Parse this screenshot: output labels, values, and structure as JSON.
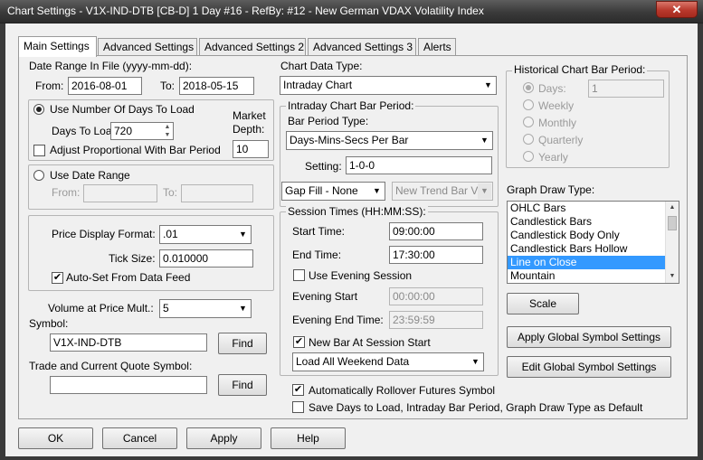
{
  "window": {
    "title": "Chart Settings - V1X-IND-DTB [CB-D]  1 Day    #16 - RefBy: #12 - New German VDAX Volatility Index",
    "close": "✕"
  },
  "tabs": [
    "Main Settings",
    "Advanced Settings",
    "Advanced Settings 2",
    "Advanced Settings 3",
    "Alerts"
  ],
  "date_range": {
    "label": "Date Range In File (yyyy-mm-dd):",
    "from_label": "From:",
    "from_value": "2016-08-01",
    "to_label": "To:",
    "to_value": "2018-05-15"
  },
  "days_group": {
    "use_days_label": "Use Number Of Days To Load",
    "days_to_load_label": "Days To Load:",
    "days_to_load_value": "720",
    "market_depth_label_1": "Market",
    "market_depth_label_2": "Depth:",
    "market_depth_value": "10",
    "adjust_label": "Adjust Proportional With Bar Period"
  },
  "date_range_group": {
    "use_date_range_label": "Use Date Range",
    "from_label": "From:",
    "to_label": "To:"
  },
  "price_group": {
    "format_label": "Price Display Format:",
    "format_value": ".01",
    "tick_size_label": "Tick Size:",
    "tick_size_value": "0.010000",
    "auto_set_label": "Auto-Set From Data Feed",
    "auto_set_checked": "✔"
  },
  "volume": {
    "label": "Volume at Price Mult.:",
    "value": "5"
  },
  "symbol": {
    "label": "Symbol:",
    "value": "V1X-IND-DTB",
    "find_label": "Find"
  },
  "trade_quote": {
    "label": "Trade and Current Quote Symbol:",
    "value": "",
    "find_label": "Find"
  },
  "chart_data_type": {
    "label": "Chart Data Type:",
    "value": "Intraday Chart"
  },
  "intraday_group": {
    "legend": "Intraday Chart Bar Period:",
    "bar_period_type_label": "Bar Period Type:",
    "bar_period_type_value": "Days-Mins-Secs Per Bar",
    "setting_label": "Setting:",
    "setting_value": "1-0-0",
    "gap_fill_value": "Gap Fill - None",
    "new_trend_value": "New Trend Bar V"
  },
  "session_group": {
    "legend": "Session Times (HH:MM:SS):",
    "start_label": "Start Time:",
    "start_value": "09:00:00",
    "end_label": "End Time:",
    "end_value": "17:30:00",
    "use_evening_label": "Use Evening Session",
    "evening_start_label": "Evening Start",
    "evening_start_value": "00:00:00",
    "evening_end_label": "Evening End Time:",
    "evening_end_value": "23:59:59",
    "new_bar_label": "New Bar At Session Start",
    "new_bar_checked": "✔",
    "weekend_value": "Load All Weekend Data"
  },
  "rollover": {
    "label": "Automatically Rollover Futures Symbol",
    "checked": "✔"
  },
  "save_defaults": {
    "label": "Save Days to Load, Intraday Bar Period, Graph Draw Type as Default"
  },
  "historical_group": {
    "legend": "Historical Chart Bar Period:",
    "options": [
      "Days:",
      "Weekly",
      "Monthly",
      "Quarterly",
      "Yearly"
    ],
    "days_value": "1"
  },
  "graph_draw": {
    "label": "Graph Draw Type:",
    "items": [
      "OHLC Bars",
      "Candlestick Bars",
      "Candlestick Body Only",
      "Candlestick Bars Hollow",
      "Line on Close",
      "Mountain"
    ],
    "selected": "Line on Close"
  },
  "buttons": {
    "scale": "Scale",
    "apply_global": "Apply Global Symbol Settings",
    "edit_global": "Edit Global Symbol Settings",
    "ok": "OK",
    "cancel": "Cancel",
    "apply": "Apply",
    "help": "Help"
  },
  "icons": {
    "dropdown": "▼",
    "spin_up": "▲",
    "spin_down": "▼"
  }
}
